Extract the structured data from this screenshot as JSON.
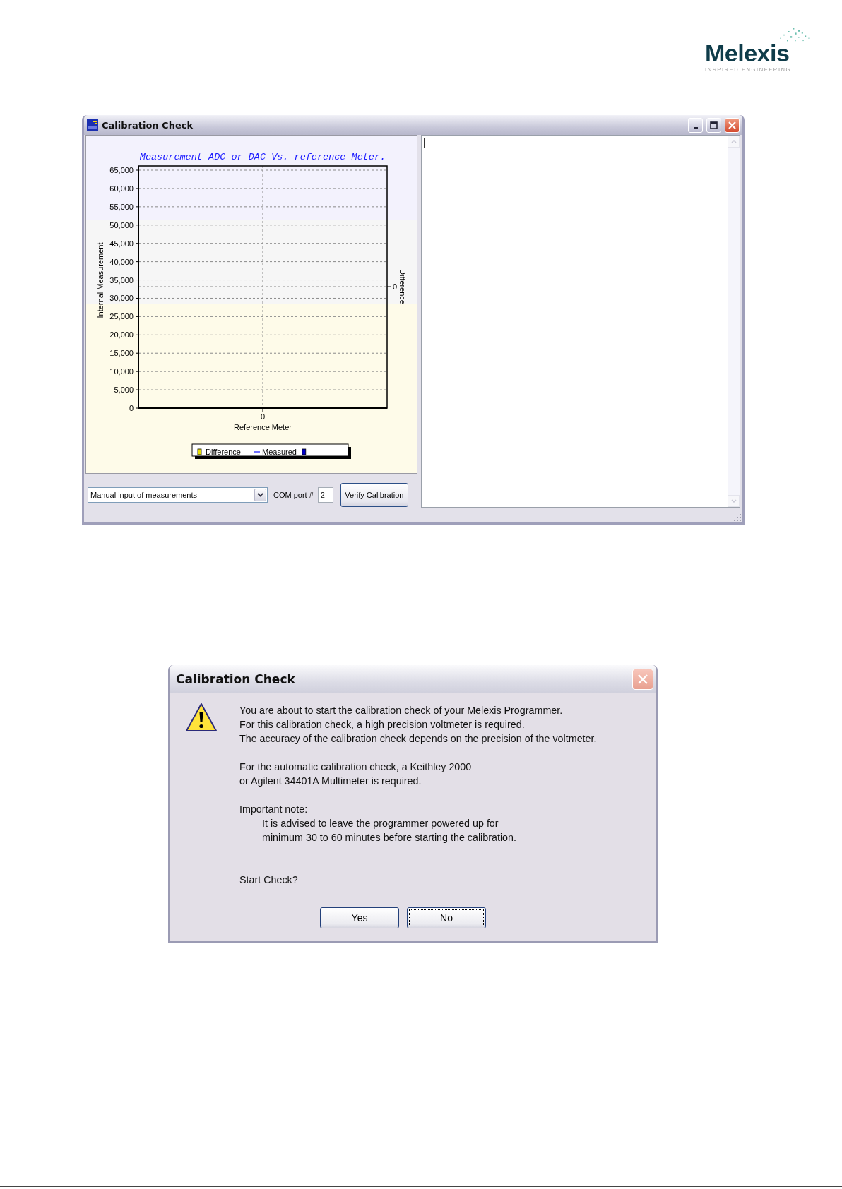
{
  "logo": {
    "wordmark": "Melexis",
    "tagline": "INSPIRED ENGINEERING"
  },
  "main_window": {
    "title": "Calibration Check",
    "chart": {
      "title": "Measurement ADC or DAC Vs. reference Meter.",
      "xlabel": "Reference Meter",
      "ylabel": "Internal Measurement",
      "y_tick_labels": [
        "65,000",
        "60,000",
        "55,000",
        "50,000",
        "45,000",
        "40,000",
        "35,000",
        "30,000",
        "25,000",
        "20,000",
        "15,000",
        "10,000",
        "5,000",
        "0"
      ],
      "x_tick": "0",
      "secondary_axis": {
        "label": "Difference",
        "tick": "0"
      },
      "legend": [
        {
          "kind": "box",
          "color": "#e8e000",
          "label": "Difference"
        },
        {
          "kind": "line",
          "color": "#7070ff",
          "label": "Measured"
        },
        {
          "kind": "box",
          "color": "#0000cc"
        }
      ]
    },
    "mode_dropdown": {
      "value": "Manual input of measurements"
    },
    "com_port": {
      "label": "COM port #",
      "value": "2"
    },
    "verify_button": "Verify Calibration"
  },
  "dialog": {
    "title": "Calibration Check",
    "paragraphs": [
      {
        "kind": "text",
        "lines": [
          "You are about to start the calibration check of your Melexis Programmer.",
          "For this calibration check, a high precision voltmeter is required.",
          "The accuracy of the calibration check depends on the precision of the voltmeter."
        ]
      },
      {
        "kind": "text",
        "lines": [
          "For the automatic calibration check, a Keithley 2000",
          "or Agilent 34401A Multimeter is required."
        ]
      },
      {
        "kind": "note",
        "heading": "Important note:",
        "lines": [
          "It is advised to leave the programmer powered up for",
          "minimum 30 to 60 minutes before starting the calibration."
        ]
      },
      {
        "kind": "prompt",
        "lines": [
          "Start Check?"
        ]
      }
    ],
    "buttons": [
      {
        "label": "Yes",
        "focused": false
      },
      {
        "label": "No",
        "focused": true
      }
    ]
  }
}
